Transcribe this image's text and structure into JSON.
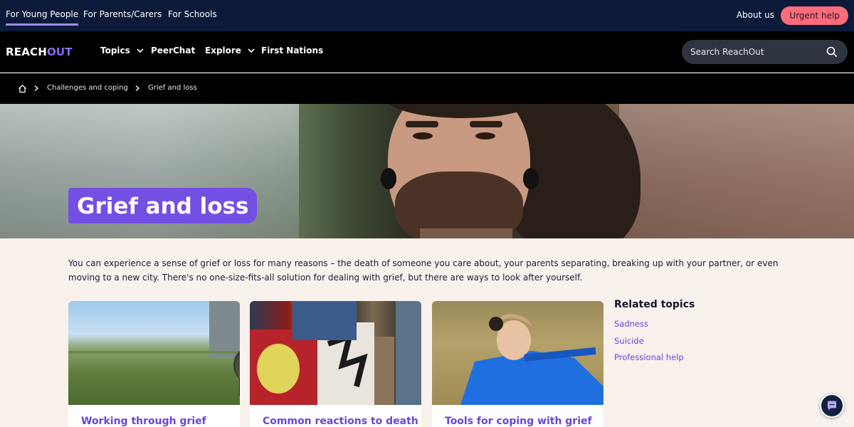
{
  "topbar": {
    "audience_links": [
      "For Young People",
      "For Parents/Carers",
      "For Schools"
    ],
    "about": "About us",
    "urgent": "Urgent help"
  },
  "nav": {
    "logo_reach": "REACH",
    "logo_out": "OUT",
    "items": [
      "Topics",
      "PeerChat",
      "Explore",
      "First Nations"
    ],
    "search_placeholder": "Search ReachOut"
  },
  "breadcrumb": [
    "Challenges and coping",
    "Grief and loss"
  ],
  "hero": {
    "title": "Grief and loss"
  },
  "intro": "You can experience a sense of grief or loss for many reasons – the death of someone you care about, your parents separating, breaking up with your partner, or even moving to a new city. There's no one-size-fits-all solution for dealing with grief, but there are ways to look after yourself.",
  "cards": [
    {
      "title": "Working through grief"
    },
    {
      "title": "Common reactions to death"
    },
    {
      "title": "Tools for coping with grief"
    }
  ],
  "related": {
    "title": "Related topics",
    "links": [
      "Sadness",
      "Suicide",
      "Professional help"
    ]
  },
  "colors": {
    "accent": "#7350e3",
    "link": "#6a44d8",
    "urgent": "#ff6b7a",
    "topbar": "#0c1a3a",
    "page_bg": "#f8f1ec"
  }
}
